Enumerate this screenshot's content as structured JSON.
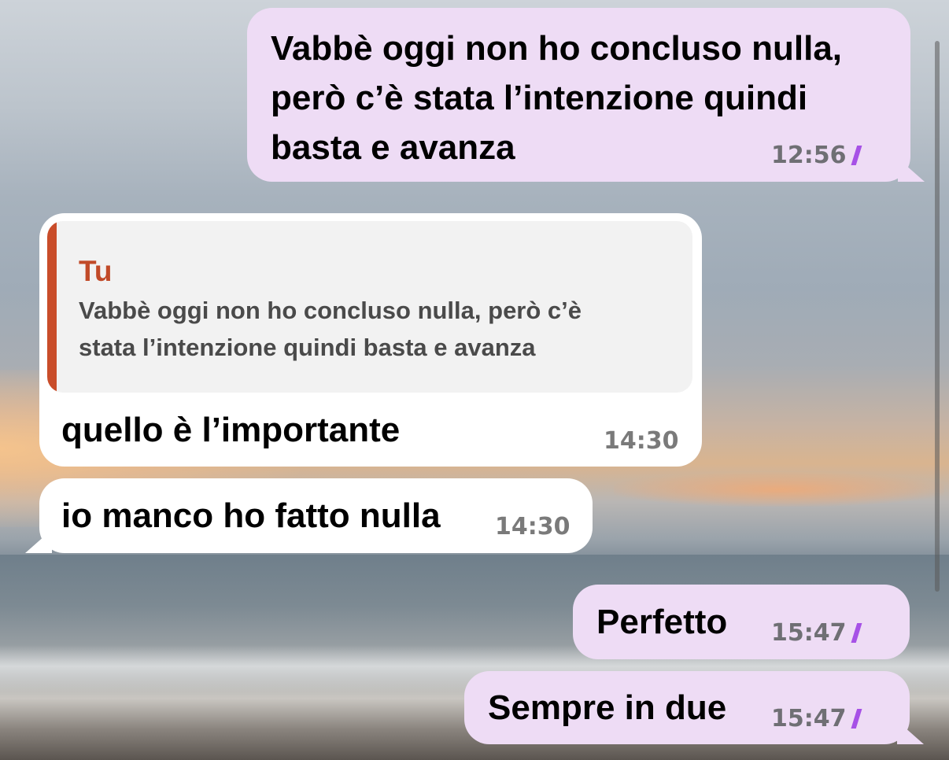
{
  "messages": [
    {
      "direction": "outgoing",
      "lines": [
        "Vabbè oggi non ho concluso nulla,",
        "però c’è stata l’intenzione quindi",
        "basta e avanza"
      ],
      "time": "12:56",
      "status": "read"
    },
    {
      "direction": "incoming",
      "reply_to": {
        "author": "Tu",
        "lines": [
          "Vabbè oggi non ho concluso nulla, però c’è",
          "stata l’intenzione quindi basta e avanza"
        ]
      },
      "text": "quello è l’importante",
      "time": "14:30"
    },
    {
      "direction": "incoming",
      "text": "io manco ho fatto nulla",
      "time": "14:30"
    },
    {
      "direction": "outgoing",
      "text": "Perfetto",
      "time": "15:47",
      "status": "read"
    },
    {
      "direction": "outgoing",
      "text": "Sempre in due",
      "time": "15:47",
      "status": "read"
    }
  ],
  "icons": {
    "read_receipt": "double-check-icon",
    "read_glyph": "//"
  },
  "colors": {
    "outgoing_bubble": "#eedcf5",
    "incoming_bubble": "#ffffff",
    "read_check": "#a651e6",
    "reply_accent": "#c94d2a"
  }
}
